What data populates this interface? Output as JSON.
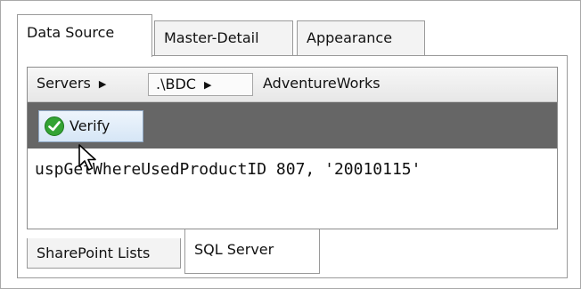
{
  "top_tabs": [
    {
      "label": "Data Source",
      "active": true
    },
    {
      "label": "Master-Detail",
      "active": false
    },
    {
      "label": "Appearance",
      "active": false
    }
  ],
  "breadcrumb": {
    "items": [
      {
        "label": "Servers"
      },
      {
        "label": ".\\BDC"
      },
      {
        "label": "AdventureWorks"
      }
    ],
    "separator_icon": "chevron-right-icon"
  },
  "toolbar": {
    "verify_label": "Verify",
    "verify_icon": "green-check-icon"
  },
  "query": {
    "text": "uspGetWhereUsedProductID 807, '20010115'"
  },
  "bottom_tabs": [
    {
      "label": "SharePoint Lists",
      "active": false
    },
    {
      "label": "SQL Server",
      "active": true
    }
  ],
  "colors": {
    "toolbar_bg": "#666666",
    "button_bg": "#dbe8f5",
    "check_green": "#34a334"
  }
}
